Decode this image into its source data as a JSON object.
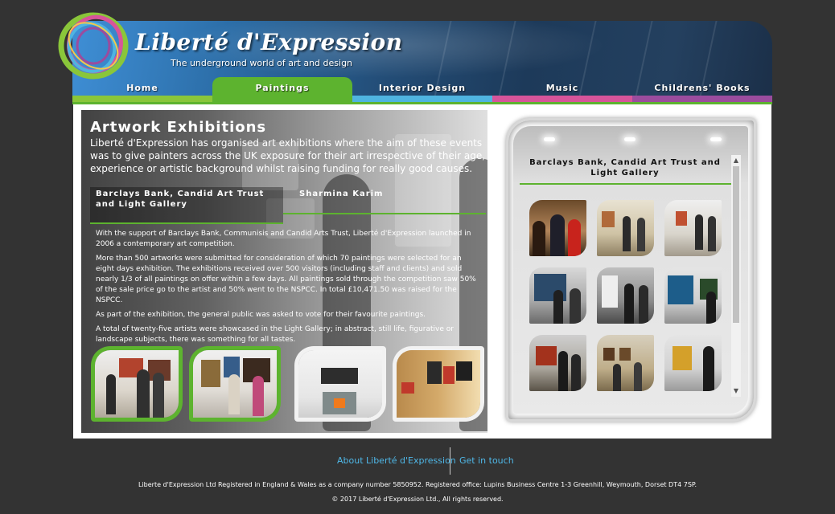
{
  "header": {
    "title": "Liberté d'Expression",
    "tagline": "The underground world of art and design"
  },
  "nav": {
    "items": [
      {
        "label": "Home",
        "color": "#8ac63a"
      },
      {
        "label": "Paintings",
        "color": "#5db32f",
        "active": true
      },
      {
        "label": "Interior Design",
        "color": "#4fb4e0"
      },
      {
        "label": "Music",
        "color": "#d7549a"
      },
      {
        "label": "Childrens' Books",
        "color": "#9b4c9e"
      }
    ]
  },
  "main": {
    "title": "Artwork Exhibitions",
    "intro": "Liberté d'Expression has organised art exhibitions where the aim of these events was to give painters across the UK exposure for their art irrespective of their age, experience or artistic background whilst raising funding for really good causes.",
    "tabs": [
      {
        "label": "Barclays Bank, Candid Art Trust and Light Gallery",
        "active": true
      },
      {
        "label": "Sharmina Karim",
        "active": false
      }
    ],
    "paragraphs": [
      "With the support of Barclays Bank, Communisis and Candid Arts Trust, Liberté d'Expression launched in 2006 a contemporary art competition.",
      "More than 500 artworks were submitted for consideration of which 70 paintings were selected for an eight days exhibition. The exhibitions received over 500 visitors (including staff and clients) and sold nearly 1/3 of all paintings on offer within a few days. All paintings sold through the competition saw 50% of the sale price go to the artist and 50% went to the NSPCC. In total £10,471.50 was raised for the NSPCC.",
      "As part of the exhibition, the general public was asked to vote for their favourite paintings.",
      "A total of twenty-five artists were showcased in the Light Gallery; in abstract, still life, figurative or landscape subjects, there was something for all tastes."
    ]
  },
  "gallery": {
    "title": "Barclays Bank, Candid Art Trust and Light Gallery"
  },
  "footer": {
    "link_about": "About Liberté d'Expression",
    "link_contact": "Get in touch",
    "registration": "Liberte d'Expression Ltd Registered in England & Wales as a company number 5850952. Registered office: Lupins Business Centre 1-3 Greenhill, Weymouth, Dorset DT4 7SP.",
    "copyright": "© 2017 Liberté d'Expression Ltd., All rights reserved."
  },
  "colors": {
    "accent_green": "#5db32f",
    "background": "#333333",
    "footer_link": "#4fb8e8"
  }
}
